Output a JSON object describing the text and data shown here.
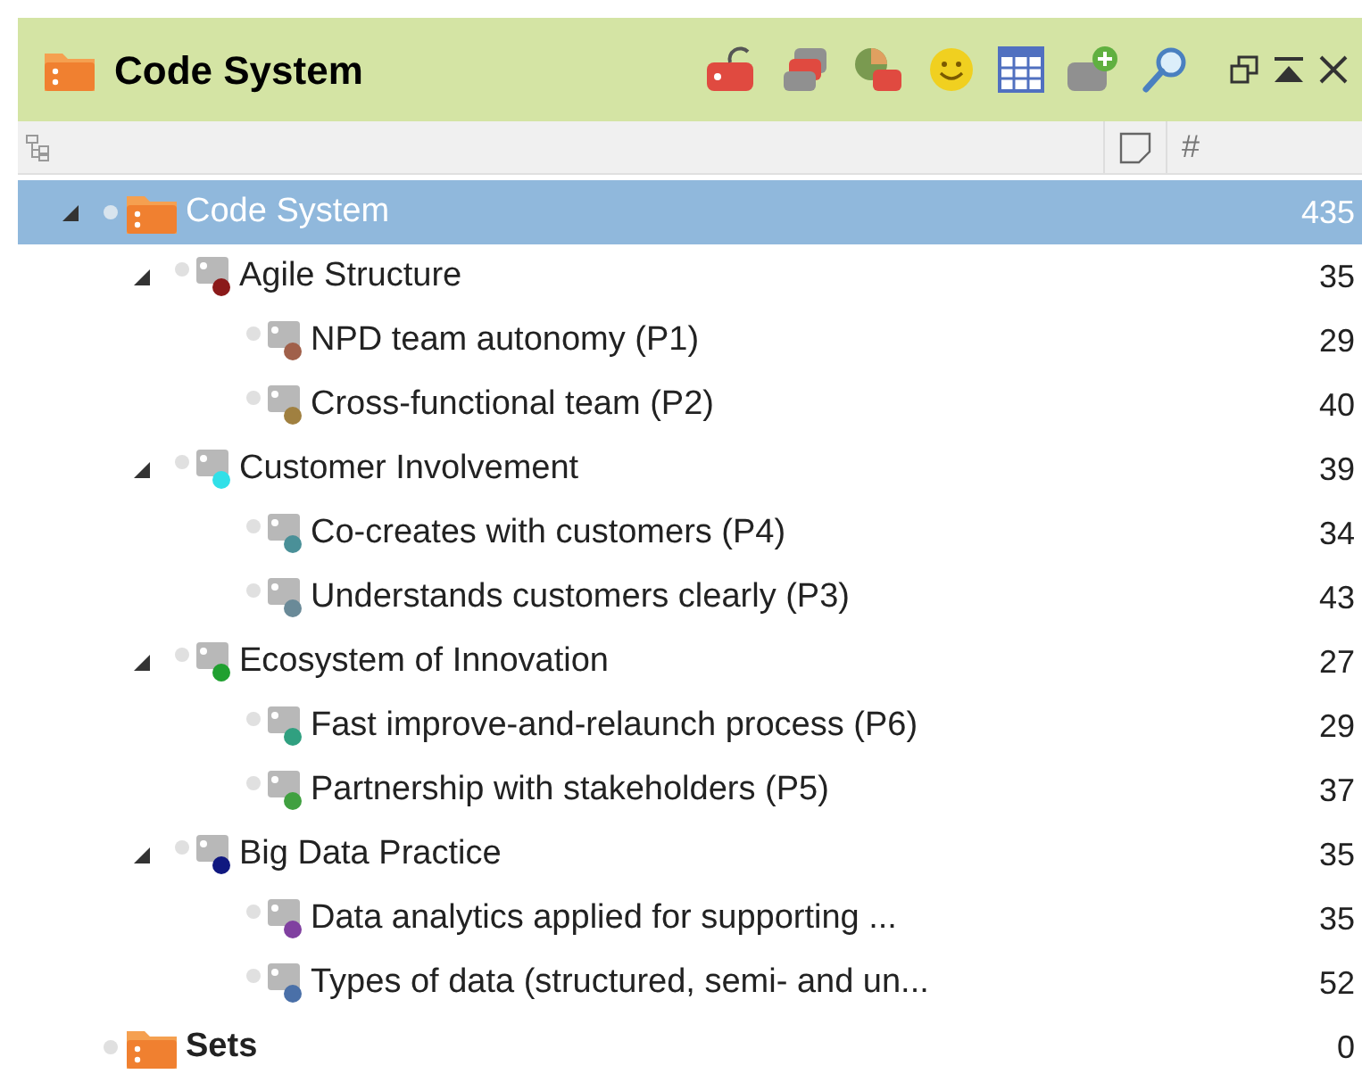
{
  "window": {
    "title": "Code System"
  },
  "columns": {
    "count_header": "#"
  },
  "tree": [
    {
      "label": "Code System",
      "count": "435",
      "kind": "root",
      "selected": true,
      "expanded": true,
      "children": [
        {
          "label": "Agile Structure",
          "count": "35",
          "color": "#8b1a1a",
          "selected": false,
          "expanded": true,
          "children": [
            {
              "label": "NPD team autonomy (P1)",
              "count": "29",
              "color": "#a0604a",
              "selected": false
            },
            {
              "label": "Cross-functional team (P2)",
              "count": "40",
              "color": "#a08040",
              "selected": false
            }
          ]
        },
        {
          "label": "Customer Involvement",
          "count": "39",
          "color": "#30e0e8",
          "selected": false,
          "expanded": true,
          "children": [
            {
              "label": "Co-creates with customers (P4)",
              "count": "34",
              "color": "#4a9098",
              "selected": false
            },
            {
              "label": "Understands customers clearly (P3)",
              "count": "43",
              "color": "#6a8a98",
              "selected": false
            }
          ]
        },
        {
          "label": "Ecosystem of Innovation",
          "count": "27",
          "color": "#20a030",
          "selected": false,
          "expanded": true,
          "children": [
            {
              "label": "Fast improve-and-relaunch process (P6)",
              "count": "29",
              "color": "#30a080",
              "selected": false
            },
            {
              "label": "Partnership with stakeholders (P5)",
              "count": "37",
              "color": "#40a040",
              "selected": false
            }
          ]
        },
        {
          "label": "Big Data Practice",
          "count": "35",
          "color": "#101880",
          "selected": false,
          "expanded": true,
          "children": [
            {
              "label": "Data analytics applied for supporting ...",
              "count": "35",
              "color": "#8040a0",
              "selected": false
            },
            {
              "label": "Types of data (structured, semi- and un...",
              "count": "52",
              "color": "#4a70a8",
              "selected": false
            }
          ]
        }
      ]
    },
    {
      "label": "Sets",
      "count": "0",
      "kind": "sets",
      "selected": false
    }
  ]
}
